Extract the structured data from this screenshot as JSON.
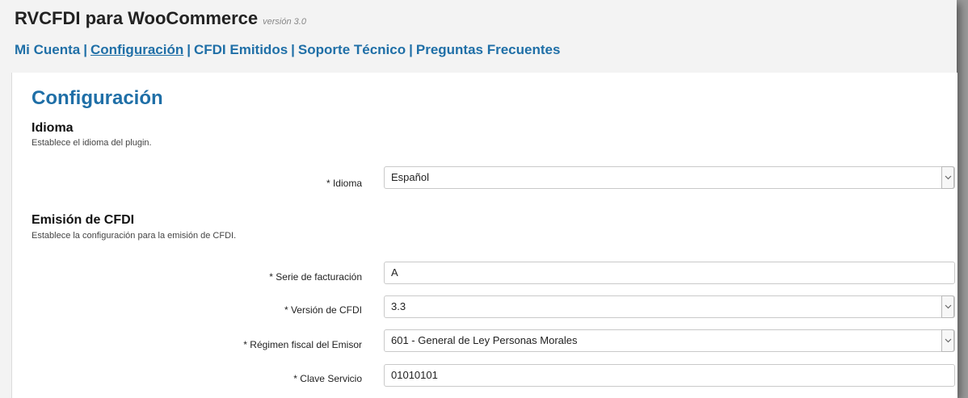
{
  "app": {
    "title": "RVCFDI para WooCommerce",
    "version": "versión 3.0"
  },
  "nav": {
    "items": [
      {
        "label": "Mi Cuenta",
        "active": false
      },
      {
        "label": "Configuración",
        "active": true
      },
      {
        "label": "CFDI Emitidos",
        "active": false
      },
      {
        "label": "Soporte Técnico",
        "active": false
      },
      {
        "label": "Preguntas Frecuentes",
        "active": false
      }
    ],
    "separator": "|"
  },
  "page": {
    "title": "Configuración"
  },
  "sections": {
    "idioma": {
      "title": "Idioma",
      "description": "Establece el idioma del plugin."
    },
    "emision": {
      "title": "Emisión de CFDI",
      "description": "Establece la configuración para la emisión de CFDI."
    }
  },
  "fields": {
    "idioma": {
      "label": "* Idioma",
      "value": "Español",
      "type": "select"
    },
    "serie": {
      "label": "* Serie de facturación",
      "value": "A",
      "type": "text"
    },
    "version": {
      "label": "* Versión de CFDI",
      "value": "3.3",
      "type": "select"
    },
    "regimen": {
      "label": "* Régimen fiscal del Emisor",
      "value": "601 - General de Ley Personas Morales",
      "type": "select"
    },
    "clave": {
      "label": "* Clave Servicio",
      "value": "01010101",
      "type": "text"
    }
  },
  "colors": {
    "accent": "#1f6fa7",
    "header_bg": "#f3f3f3",
    "content_bg": "#ffffff"
  },
  "icons": {
    "select_arrow": "chevron-down-icon"
  }
}
